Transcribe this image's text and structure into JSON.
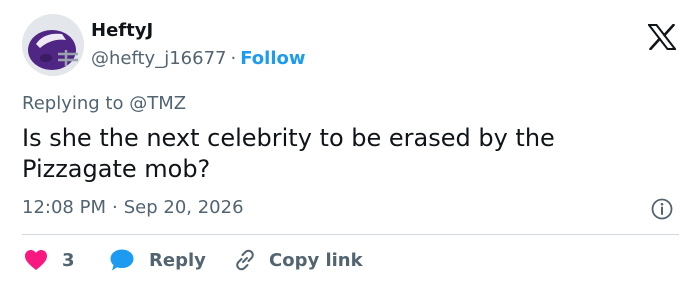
{
  "author": {
    "display_name": "HeftyJ",
    "handle": "@hefty_j16677",
    "separator": "·",
    "follow_label": "Follow"
  },
  "reply_context": {
    "prefix": "Replying to",
    "mention": "@TMZ"
  },
  "tweet": {
    "text": "Is she the next celebrity to be erased by the Pizzagate mob?"
  },
  "meta": {
    "time": "12:08 PM",
    "separator": "·",
    "date": "Sep 20, 2026"
  },
  "actions": {
    "like_count": "3",
    "reply_label": "Reply",
    "copy_link_label": "Copy link"
  },
  "icons": {
    "like": "heart-icon",
    "reply": "speech-bubble-icon",
    "copy_link": "link-icon",
    "info": "info-icon",
    "brand": "x-logo"
  },
  "colors": {
    "text_primary": "#0f1419",
    "text_secondary": "#536471",
    "link_blue": "#1d9bf0",
    "like_pink": "#f91880",
    "divider": "#cfd9de"
  }
}
